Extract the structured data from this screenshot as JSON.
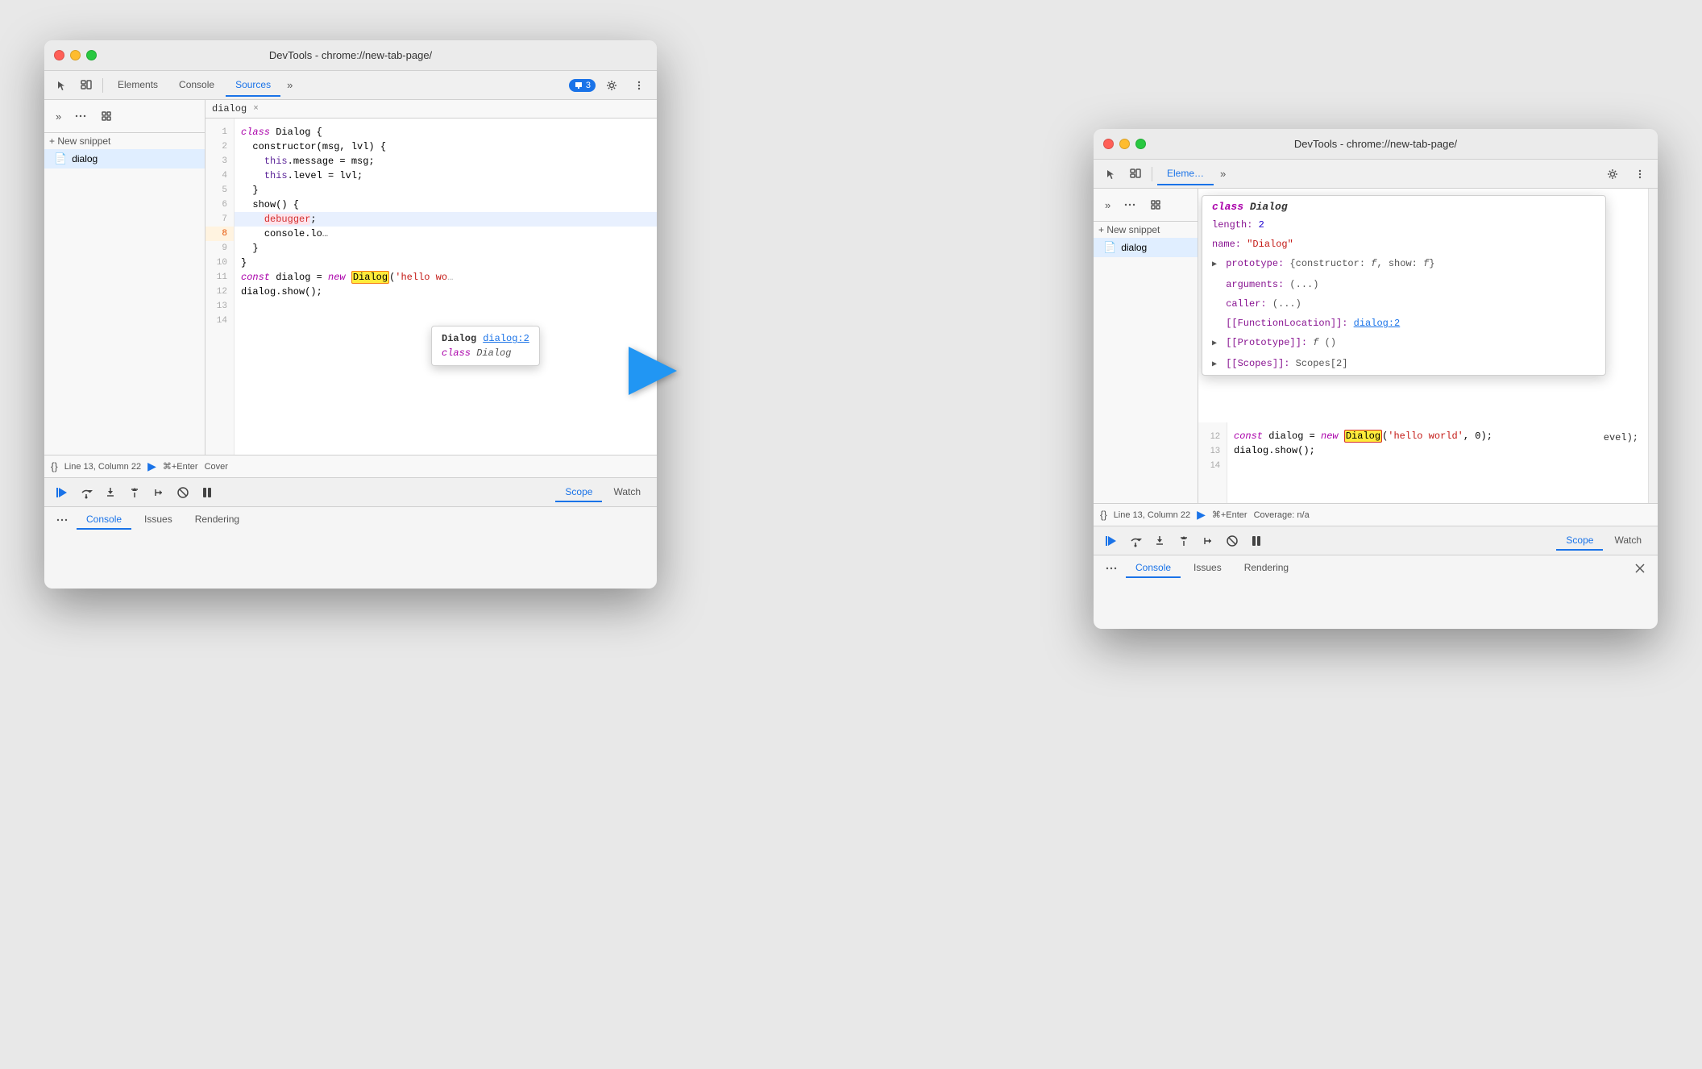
{
  "window1": {
    "title": "DevTools - chrome://new-tab-page/",
    "tabs": [
      "Elements",
      "Console",
      "Sources"
    ],
    "active_tab": "Sources",
    "tab_more": "»",
    "notification_count": "3",
    "sidebar": {
      "new_snippet": "+ New snippet",
      "file": "dialog"
    },
    "code": {
      "file_tab": "dialog",
      "lines": [
        {
          "num": 1,
          "text": "class Dialog {"
        },
        {
          "num": 2,
          "text": "  constructor(msg, lvl) {"
        },
        {
          "num": 3,
          "text": "    this.message = msg;"
        },
        {
          "num": 4,
          "text": "    this.level = lvl;"
        },
        {
          "num": 5,
          "text": "  }"
        },
        {
          "num": 6,
          "text": ""
        },
        {
          "num": 7,
          "text": "  show() {"
        },
        {
          "num": 8,
          "text": "    debugger;",
          "highlight": true
        },
        {
          "num": 9,
          "text": "    console.log(this"
        },
        {
          "num": 10,
          "text": "  }"
        },
        {
          "num": 11,
          "text": "}"
        },
        {
          "num": 12,
          "text": ""
        },
        {
          "num": 13,
          "text": "const dialog = new Dialog('hello wo"
        },
        {
          "num": 14,
          "text": "dialog.show();"
        }
      ]
    },
    "status_bar": {
      "line_col": "Line 13, Column 22",
      "run_cmd": "⌘+Enter",
      "coverage": "Cover"
    },
    "tooltip": {
      "class_name": "Dialog",
      "link": "dialog:2",
      "class_label": "class Dialog"
    },
    "debug_toolbar": {
      "tabs": [
        "Scope",
        "Watch"
      ],
      "active_tab": "Scope"
    },
    "bottom_tabs": [
      "Console",
      "Issues",
      "Rendering"
    ]
  },
  "window2": {
    "title": "DevTools - chrome://new-tab-page/",
    "tabs": [
      "Eleme"
    ],
    "active_tab": "Eleme",
    "sidebar": {
      "new_snippet": "+ New snippet",
      "file": "dialog"
    },
    "scope_panel": {
      "class_name": "class Dialog",
      "items": [
        {
          "key": "length:",
          "value": "2",
          "type": "num"
        },
        {
          "key": "name:",
          "value": "\"Dialog\"",
          "type": "str"
        },
        {
          "key": "prototype:",
          "value": "{constructor: f, show: f}",
          "type": "obj",
          "expandable": true
        },
        {
          "key": "arguments:",
          "value": "(...)",
          "type": "fn"
        },
        {
          "key": "caller:",
          "value": "(...)",
          "type": "fn"
        },
        {
          "key": "[[FunctionLocation]]:",
          "value": "dialog:2",
          "type": "link"
        },
        {
          "key": "[[Prototype]]:",
          "value": "f ()",
          "type": "fn",
          "expandable": true
        },
        {
          "key": "[[Scopes]]:",
          "value": "Scopes[2]",
          "type": "obj",
          "expandable": true
        }
      ]
    },
    "code": {
      "lines": [
        {
          "num": 12,
          "text": ""
        },
        {
          "num": 13,
          "text": "const dialog = new Dialog('hello world', 0);"
        },
        {
          "num": 14,
          "text": "dialog.show();"
        }
      ]
    },
    "status_bar": {
      "line_col": "Line 13, Column 22",
      "run_cmd": "⌘+Enter",
      "coverage": "Coverage: n/a"
    },
    "debug_toolbar": {
      "tabs": [
        "Scope",
        "Watch"
      ],
      "active_tab": "Scope"
    },
    "bottom_tabs": [
      "Console",
      "Issues",
      "Rendering"
    ],
    "close_label": "×"
  },
  "arrow": {
    "direction": "right"
  }
}
